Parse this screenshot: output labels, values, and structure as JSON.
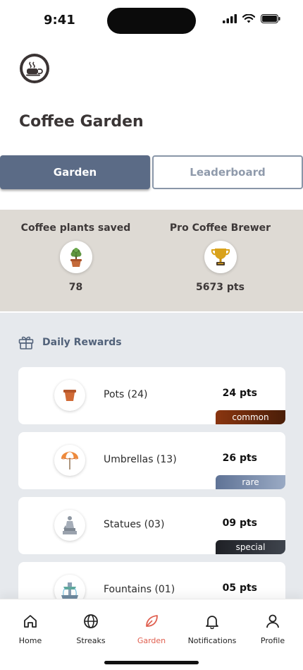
{
  "status_bar": {
    "time": "9:41"
  },
  "header": {
    "title": "Coffee Garden",
    "logo_icon": "coffee-cup-icon"
  },
  "tabs": [
    {
      "label": "Garden",
      "active": true
    },
    {
      "label": "Leaderboard",
      "active": false
    }
  ],
  "stats": [
    {
      "label": "Coffee plants saved",
      "icon": "potted-tree-icon",
      "value": "78"
    },
    {
      "label": "Pro Coffee Brewer",
      "icon": "trophy-icon",
      "value": "5673 pts"
    }
  ],
  "daily_rewards": {
    "title": "Daily Rewards",
    "icon": "gift-icon",
    "items": [
      {
        "name": "Pots (24)",
        "points": "24 pts",
        "rarity": "common",
        "icon": "pot-icon",
        "badge_color": "#6e2d0e"
      },
      {
        "name": "Umbrellas (13)",
        "points": "26 pts",
        "rarity": "rare",
        "icon": "umbrella-icon",
        "badge_color": "#7588a8"
      },
      {
        "name": "Statues (03)",
        "points": "09 pts",
        "rarity": "special",
        "icon": "statue-icon",
        "badge_color": "#2a2d33"
      },
      {
        "name": "Fountains (01)",
        "points": "05 pts",
        "rarity": "",
        "icon": "fountain-icon",
        "badge_color": ""
      }
    ]
  },
  "nav": [
    {
      "label": "Home",
      "icon": "home-icon",
      "active": false
    },
    {
      "label": "Streaks",
      "icon": "globe-icon",
      "active": false
    },
    {
      "label": "Garden",
      "icon": "leaf-icon",
      "active": true
    },
    {
      "label": "Notifications",
      "icon": "bell-icon",
      "active": false
    },
    {
      "label": "Profile",
      "icon": "person-icon",
      "active": false
    }
  ],
  "colors": {
    "accent": "#5b6b86",
    "nav_active": "#e05f4f",
    "stats_bg": "#dedad4",
    "content_bg": "#e6e9ed"
  }
}
